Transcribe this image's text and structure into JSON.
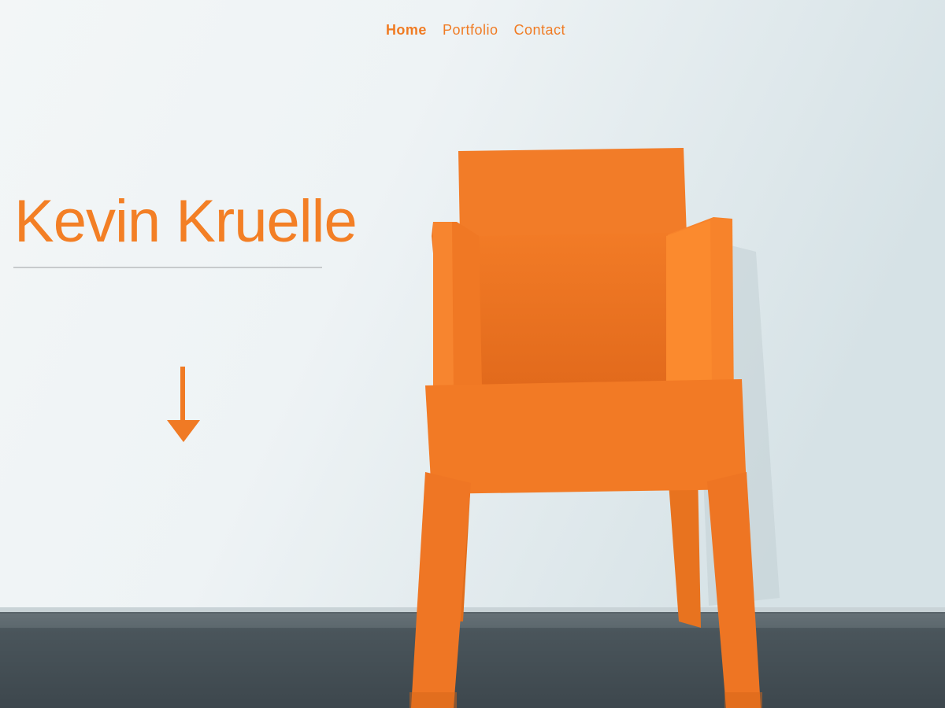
{
  "nav": {
    "items": [
      {
        "label": "Home",
        "active": true
      },
      {
        "label": "Portfolio",
        "active": false
      },
      {
        "label": "Contact",
        "active": false
      }
    ]
  },
  "hero": {
    "title": "Kevin Kruelle",
    "scroll_icon": "arrow-down-icon",
    "image_subject": "orange-chair-photo"
  },
  "colors": {
    "accent": "#f37f25",
    "nav_text": "#f07b23",
    "wall": "#e9eff1",
    "floor": "#465158",
    "chair": "#f07a24",
    "rule": "#c7cacc"
  }
}
